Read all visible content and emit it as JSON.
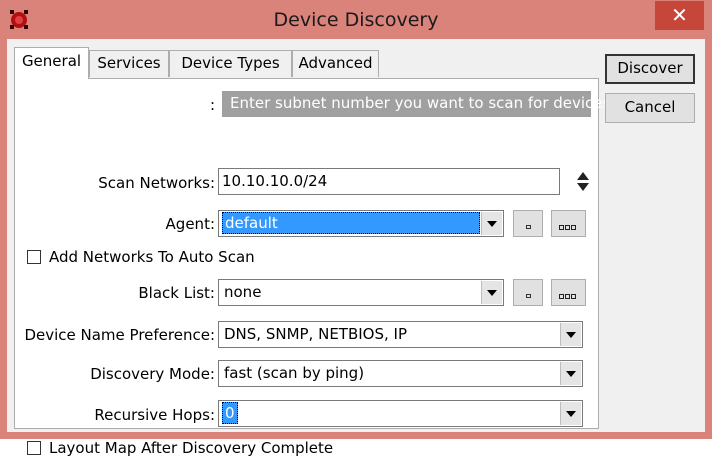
{
  "window": {
    "title": "Device Discovery",
    "close_glyph": "✕"
  },
  "tabs": [
    {
      "label": "General",
      "active": true
    },
    {
      "label": "Services",
      "active": false
    },
    {
      "label": "Device Types",
      "active": false
    },
    {
      "label": "Advanced",
      "active": false
    }
  ],
  "general": {
    "hint_label": ":",
    "hint_text": "Enter subnet number you want to scan for devices",
    "scan_networks": {
      "label": "Scan Networks:",
      "value": "10.10.10.0/24"
    },
    "agent": {
      "label": "Agent:",
      "value": "default"
    },
    "add_networks_auto_scan": {
      "label": "Add Networks To Auto Scan",
      "checked": false
    },
    "black_list": {
      "label": "Black List:",
      "value": "none"
    },
    "device_name_preference": {
      "label": "Device Name Preference:",
      "value": "DNS, SNMP, NETBIOS, IP"
    },
    "discovery_mode": {
      "label": "Discovery Mode:",
      "value": "fast (scan by ping)"
    },
    "recursive_hops": {
      "label": "Recursive Hops:",
      "value": "0"
    },
    "layout_map_after_discovery": {
      "label": "Layout Map After Discovery Complete",
      "checked": false
    }
  },
  "buttons": {
    "discover": "Discover",
    "cancel": "Cancel"
  },
  "colors": {
    "titlebar": "#d9837b",
    "close": "#c7463a",
    "selection": "#3399ff",
    "hint_bg": "#a0a0a0"
  },
  "icons": [
    "app-icon",
    "close-icon",
    "dropdown-arrow-icon",
    "spin-up-down-icon",
    "square-icon",
    "ellipsis-icon"
  ]
}
